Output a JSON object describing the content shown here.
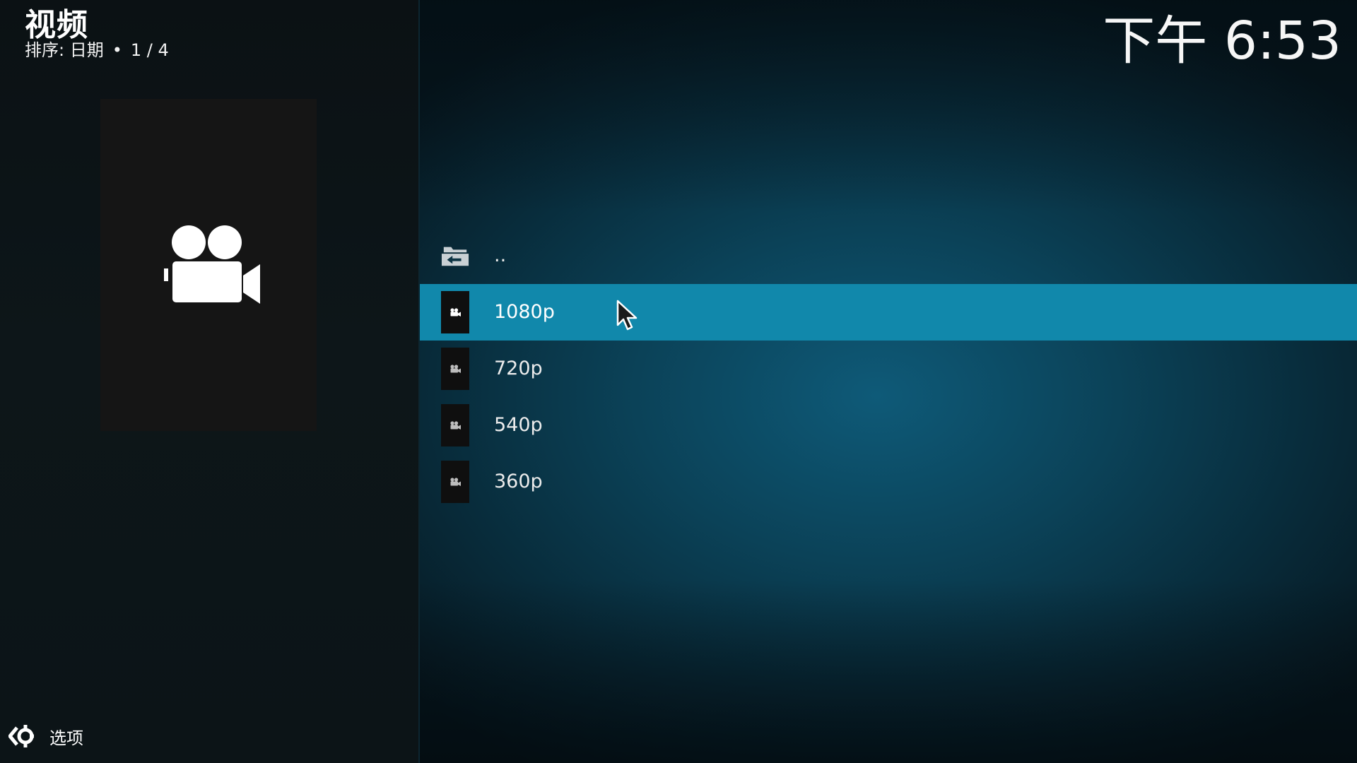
{
  "header": {
    "title": "视频",
    "sort_label": "排序: 日期",
    "separator": "•",
    "page_indicator": "1 / 4"
  },
  "clock": {
    "time": "下午 6:53"
  },
  "poster": {
    "icon": "video-camera-icon"
  },
  "file_list": {
    "items": [
      {
        "label": "..",
        "icon": "parent-folder-icon",
        "selected": false
      },
      {
        "label": "1080p",
        "icon": "video-camera-icon",
        "selected": true
      },
      {
        "label": "720p",
        "icon": "video-camera-icon",
        "selected": false
      },
      {
        "label": "540p",
        "icon": "video-camera-icon",
        "selected": false
      },
      {
        "label": "360p",
        "icon": "video-camera-icon",
        "selected": false
      }
    ]
  },
  "footer": {
    "options_label": "选项",
    "options_icon": "options-gear-icon"
  },
  "colors": {
    "accent": "#1188ab",
    "left_panel": "#0d1619",
    "poster_bg": "#151515",
    "thumb_bg": "#0f0f0f"
  }
}
